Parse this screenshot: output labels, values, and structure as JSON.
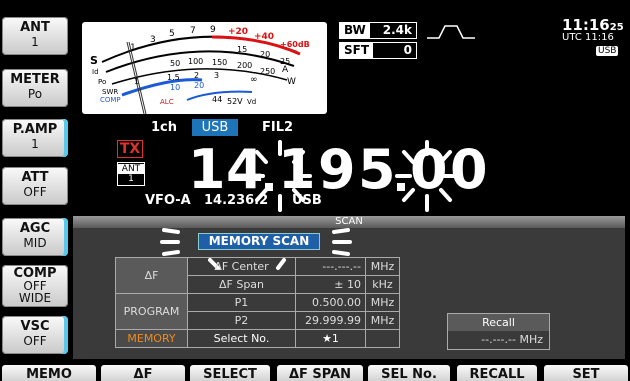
{
  "side_buttons": [
    {
      "label": "ANT",
      "value": "1"
    },
    {
      "label": "METER",
      "value": "Po"
    },
    {
      "label": "P.AMP",
      "value": "1"
    },
    {
      "label": "ATT",
      "value": "OFF"
    },
    {
      "label": "AGC",
      "value": "MID"
    },
    {
      "label": "COMP",
      "value": "OFF",
      "value2": "WIDE"
    },
    {
      "label": "VSC",
      "value": "OFF"
    }
  ],
  "bottom_buttons": [
    "MEMO",
    "ΔF",
    "SELECT",
    "ΔF SPAN",
    "SEL No.",
    "RECALL",
    "SET"
  ],
  "meter": {
    "top_scale": [
      "1",
      "3",
      "5",
      "7",
      "9",
      "+20",
      "+40",
      "+60dB"
    ],
    "s_label": "S",
    "po_scale": [
      "0",
      "50",
      "100",
      "150",
      "200",
      "250"
    ],
    "po_label": "Po",
    "swr_label": "SWR",
    "swr_scale": [
      "1",
      "1.5",
      "2",
      "3",
      "∞"
    ],
    "comp_label": "COMP",
    "comp_scale": [
      "10",
      "20"
    ],
    "alc_label": "ALC",
    "vd_scale": [
      "44",
      "52V"
    ],
    "vd_label": "Vd",
    "w_label": "W",
    "a_label": "A",
    "id_label": "Id",
    "id_scale": [
      "15",
      "20",
      "25"
    ]
  },
  "bw": {
    "label": "BW",
    "value": "2.4k"
  },
  "sft": {
    "label": "SFT",
    "value": "0"
  },
  "clock": {
    "time": "11:16",
    "sec": "25",
    "utc": "UTC 11:16",
    "mode": "USB"
  },
  "status": {
    "channel": "1ch",
    "mode": "USB",
    "filter": "FIL2"
  },
  "tx": "TX",
  "ant_badge": {
    "label": "ANT",
    "value": "1"
  },
  "frequency": {
    "main": "14.195.00",
    "digits": [
      "1",
      "4",
      "1",
      "9",
      "5",
      "0",
      "0"
    ]
  },
  "vfo": {
    "label": "VFO-A",
    "freq": "14.236.2",
    "mode": "USB"
  },
  "scan": {
    "title": "SCAN",
    "memory_scan": "MEMORY SCAN"
  },
  "grid": {
    "df": "ΔF",
    "program": "PROGRAM",
    "memory": "MEMORY",
    "rows": [
      {
        "name": "ΔF Center",
        "value": "---.---.--",
        "unit": "MHz"
      },
      {
        "name": "ΔF Span",
        "value": "± 10",
        "unit": "kHz"
      },
      {
        "name": "P1",
        "value": "0.500.00",
        "unit": "MHz"
      },
      {
        "name": "P2",
        "value": "29.999.99",
        "unit": "MHz"
      },
      {
        "name": "Select No.",
        "value": "★1",
        "unit": ""
      }
    ]
  },
  "recall": {
    "label": "Recall",
    "value": "--.---.--",
    "unit": "MHz"
  }
}
